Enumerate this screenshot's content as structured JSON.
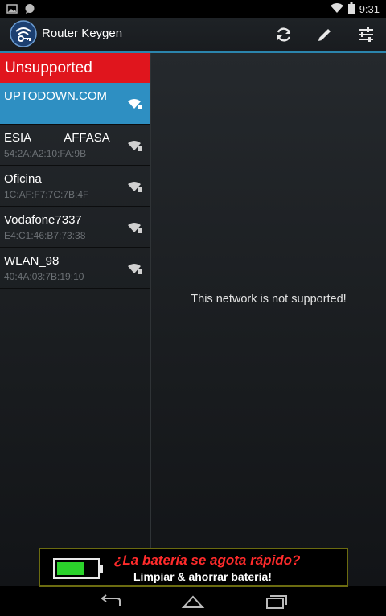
{
  "status_bar": {
    "time": "9:31",
    "icons": [
      "image-icon",
      "chat-bubble-icon",
      "wifi-icon",
      "battery-icon"
    ]
  },
  "action_bar": {
    "title": "Router Keygen",
    "actions": [
      "refresh-icon",
      "edit-pencil-icon",
      "settings-sliders-icon"
    ]
  },
  "list_header": "Unsupported",
  "networks": [
    {
      "ssid": "UPTODOWN.COM",
      "bssid": "",
      "selected": true
    },
    {
      "ssid": "ESIA          AFFASA",
      "bssid": "54:2A:A2:10:FA:9B",
      "selected": false
    },
    {
      "ssid": "Oficina",
      "bssid": "1C:AF:F7:7C:7B:4F",
      "selected": false
    },
    {
      "ssid": "Vodafone7337",
      "bssid": "E4:C1:46:B7:73:38",
      "selected": false
    },
    {
      "ssid": "WLAN_98",
      "bssid": "40:4A:03:7B:19:10",
      "selected": false
    }
  ],
  "detail_message": "This network is not supported!",
  "ad": {
    "headline": "¿La batería se agota rápido?",
    "subtext": "Limpiar & ahorrar batería!"
  },
  "nav_bar": [
    "back-icon",
    "home-icon",
    "recents-icon"
  ],
  "colors": {
    "header_red": "#e0151d",
    "selected_blue": "#2e8fc2",
    "action_bar_line": "#2b85ad"
  }
}
